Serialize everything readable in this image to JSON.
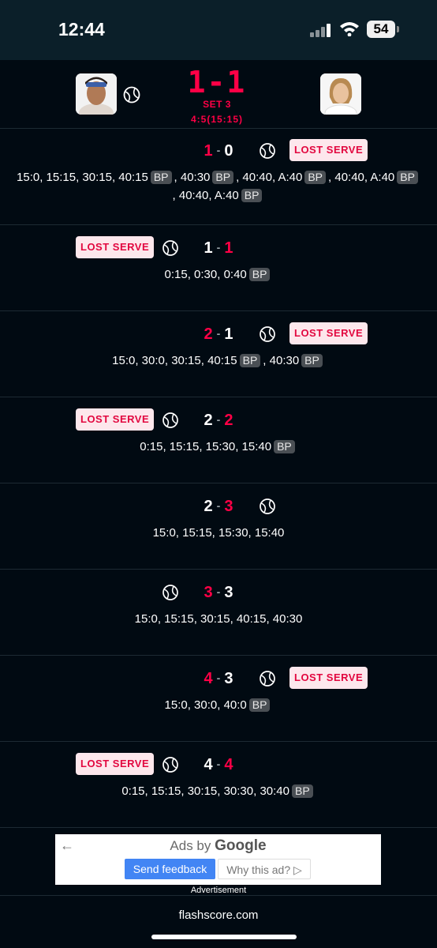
{
  "status_bar": {
    "time": "12:44",
    "battery": "54"
  },
  "header": {
    "score": "1-1",
    "set_label": "SET 3",
    "game_score": "4:5(15:15)",
    "player1_avatar": "player-one-photo",
    "player2_avatar": "player-two-photo"
  },
  "lost_serve_label": "LOST SERVE",
  "bp_label": "BP",
  "games": [
    {
      "home": "1",
      "away": "0",
      "winner": "home",
      "server": "away",
      "points": [
        [
          "15:0, 15:15, 30:15, 40:15",
          true
        ],
        [
          ", 40:30",
          true
        ],
        [
          ", 40:40, A:40",
          true
        ],
        [
          ", 40:40, A:40",
          true
        ],
        [
          ", 40:40, A:40",
          true
        ]
      ]
    },
    {
      "home": "1",
      "away": "1",
      "winner": "away",
      "server": "home",
      "points": [
        [
          "0:15, 0:30, 0:40",
          true
        ]
      ]
    },
    {
      "home": "2",
      "away": "1",
      "winner": "home",
      "server": "away",
      "points": [
        [
          "15:0, 30:0, 30:15, 40:15",
          true
        ],
        [
          ", 40:30",
          true
        ]
      ]
    },
    {
      "home": "2",
      "away": "2",
      "winner": "away",
      "server": "home",
      "points": [
        [
          "0:15, 15:15, 15:30, 15:40",
          true
        ]
      ]
    },
    {
      "home": "2",
      "away": "3",
      "winner": "away",
      "server": "away",
      "points": [
        [
          "15:0, 15:15, 15:30, 15:40",
          false
        ]
      ]
    },
    {
      "home": "3",
      "away": "3",
      "winner": "home",
      "server": "home",
      "points": [
        [
          "15:0, 15:15, 30:15, 40:15, 40:30",
          false
        ]
      ]
    },
    {
      "home": "4",
      "away": "3",
      "winner": "home",
      "server": "away",
      "points": [
        [
          "15:0, 30:0, 40:0",
          true
        ]
      ]
    },
    {
      "home": "4",
      "away": "4",
      "winner": "away",
      "server": "home",
      "points": [
        [
          "0:15, 15:15, 30:15, 30:30, 30:40",
          true
        ]
      ]
    }
  ],
  "ad": {
    "back_icon": "back-arrow-icon",
    "ads_by": "Ads by",
    "google": "Google",
    "send_feedback": "Send feedback",
    "why_this_ad": "Why this ad?",
    "caption": "Advertisement"
  },
  "footer": {
    "site": "flashscore.com"
  },
  "colors": {
    "accent": "#ff0046",
    "background": "#010a12",
    "badge_bg": "#fde7ec"
  }
}
